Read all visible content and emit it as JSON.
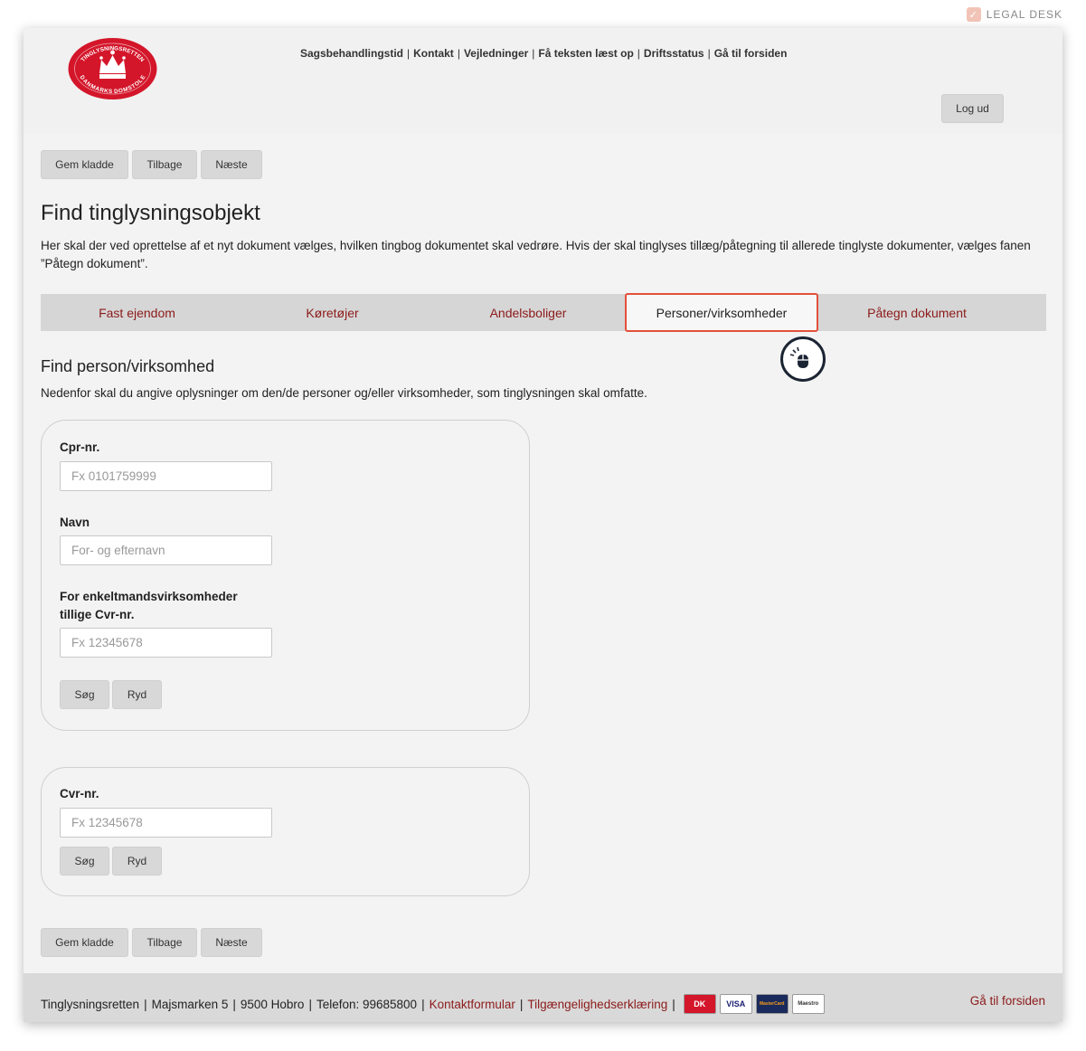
{
  "brand": {
    "label": "LEGAL DESK"
  },
  "header": {
    "logo_text": [
      "TINGLYSNINGSRETTEN",
      "DANMARKS DOMSTOLE"
    ],
    "nav": [
      "Sagsbehandlingstid",
      "Kontakt",
      "Vejledninger",
      "Få teksten læst op",
      "Driftsstatus",
      "Gå til forsiden"
    ],
    "logout_label": "Log ud"
  },
  "actions": {
    "save_draft": "Gem kladde",
    "back": "Tilbage",
    "next": "Næste"
  },
  "page": {
    "title": "Find tinglysningsobjekt",
    "intro": "Her skal der ved oprettelse af et nyt dokument vælges, hvilken tingbog dokumentet skal vedrøre. Hvis der skal tinglyses tillæg/påtegning til allerede tinglyste dokumenter, vælges fanen ”Påtegn dokument”."
  },
  "tabs": [
    {
      "label": "Fast ejendom",
      "active": false
    },
    {
      "label": "Køretøjer",
      "active": false
    },
    {
      "label": "Andelsboliger",
      "active": false
    },
    {
      "label": "Personer/virksomheder",
      "active": true
    },
    {
      "label": "Påtegn dokument",
      "active": false
    }
  ],
  "section": {
    "title": "Find person/virksomhed",
    "description": "Nedenfor skal du angive oplysninger om den/de personer og/eller virksomheder, som tinglysningen skal omfatte."
  },
  "person_form": {
    "cpr_label": "Cpr-nr.",
    "cpr_placeholder": "Fx 0101759999",
    "name_label": "Navn",
    "name_placeholder": "For- og efternavn",
    "cvr_label_line1": "For enkeltmandsvirksomheder",
    "cvr_label_line2": "tillige Cvr-nr.",
    "cvr_placeholder": "Fx 12345678",
    "search_label": "Søg",
    "clear_label": "Ryd"
  },
  "company_form": {
    "cvr_label": "Cvr-nr.",
    "cvr_placeholder": "Fx 12345678",
    "search_label": "Søg",
    "clear_label": "Ryd"
  },
  "footer": {
    "org": "Tinglysningsretten",
    "address": "Majsmarken 5",
    "city": "9500 Hobro",
    "phone": "Telefon: 99685800",
    "contact_form": "Kontaktformular",
    "accessibility": "Tilgængelighedserklæring",
    "cards": [
      "DK",
      "VISA",
      "MasterCard",
      "Maestro"
    ],
    "home_link": "Gå til forsiden"
  },
  "colors": {
    "accent": "#8c1a1a",
    "logo_red": "#d4162a",
    "active_tab_border": "#e2513a"
  }
}
